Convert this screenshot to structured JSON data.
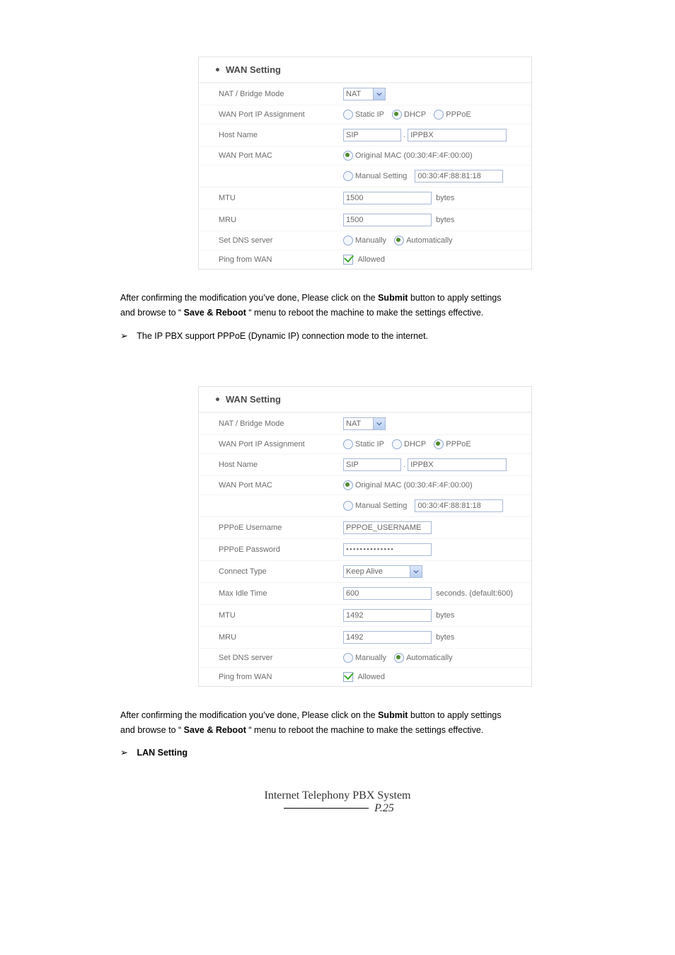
{
  "sshot_a": {
    "heading": "WAN Setting",
    "rows": {
      "natBridge": {
        "label": "NAT / Bridge Mode",
        "select": "NAT"
      },
      "ipAssign": {
        "label": "WAN Port IP Assignment",
        "opts": [
          "Static IP",
          "DHCP",
          "PPPoE"
        ],
        "selectedIdx": 1
      },
      "hostName": {
        "label": "Host Name",
        "v1": "SIP",
        "v2": "IPPBX",
        "dot": "."
      },
      "wanMac": {
        "label": "WAN Port MAC",
        "origLabel": "Original MAC (00:30:4F:4F:00:00)",
        "origChecked": true,
        "manualLabel": "Manual Setting",
        "manualChecked": false,
        "manualValue": "00:30:4F:88:81:18"
      },
      "mtu": {
        "label": "MTU",
        "value": "1500",
        "unit": "bytes"
      },
      "mru": {
        "label": "MRU",
        "value": "1500",
        "unit": "bytes"
      },
      "dns": {
        "label": "Set DNS server",
        "opts": [
          "Manually",
          "Automatically"
        ],
        "selectedIdx": 1
      },
      "ping": {
        "label": "Ping from WAN",
        "chkLabel": "Allowed",
        "checked": true
      }
    }
  },
  "text_a": {
    "lead": "After confirming the modification you’ve done, Please click on the ",
    "bold1": "Submit",
    "tail1": " button to apply settings",
    "tail2": "and browse to “",
    "bold2": "Save & Reboot",
    "tail3": "“ menu to reboot the machine to make the settings effective.",
    "bullet_line": "The IP PBX support PPPoE (Dynamic IP) connection mode to the internet."
  },
  "sshot_b": {
    "heading": "WAN Setting",
    "rows": {
      "natBridge": {
        "label": "NAT / Bridge Mode",
        "select": "NAT"
      },
      "ipAssign": {
        "label": "WAN Port IP Assignment",
        "opts": [
          "Static IP",
          "DHCP",
          "PPPoE"
        ],
        "selectedIdx": 2
      },
      "hostName": {
        "label": "Host Name",
        "v1": "SIP",
        "v2": "IPPBX",
        "dot": "."
      },
      "wanMac": {
        "label": "WAN Port MAC",
        "origLabel": "Original MAC (00:30:4F:4F:00:00)",
        "origChecked": true,
        "manualLabel": "Manual Setting",
        "manualChecked": false,
        "manualValue": "00:30:4F:88:81:18"
      },
      "pppoeUser": {
        "label": "PPPoE Username",
        "value": "PPPOE_USERNAME"
      },
      "pppoePass": {
        "label": "PPPoE Password",
        "value": "••••••••••••••"
      },
      "connType": {
        "label": "Connect Type",
        "select": "Keep Alive"
      },
      "maxIdle": {
        "label": "Max Idle Time",
        "value": "600",
        "unit": "seconds. (default:600)"
      },
      "mtu": {
        "label": "MTU",
        "value": "1492",
        "unit": "bytes"
      },
      "mru": {
        "label": "MRU",
        "value": "1492",
        "unit": "bytes"
      },
      "dns": {
        "label": "Set DNS server",
        "opts": [
          "Manually",
          "Automatically"
        ],
        "selectedIdx": 1
      },
      "ping": {
        "label": "Ping from WAN",
        "chkLabel": "Allowed",
        "checked": true
      }
    }
  },
  "text_b": {
    "lead": "After confirming the modification you’ve done, Please click on the ",
    "bold1": "Submit",
    "tail1": " button to apply settings",
    "tail2": "and browse to “",
    "bold2": "Save & Reboot",
    "tail3": "“ menu to reboot the machine to make the settings effective.",
    "bullet_line": "LAN Setting"
  },
  "doc_title": {
    "line1": "Internet Telephony PBX System",
    "line2underline": "",
    "line2right": "P.25"
  }
}
